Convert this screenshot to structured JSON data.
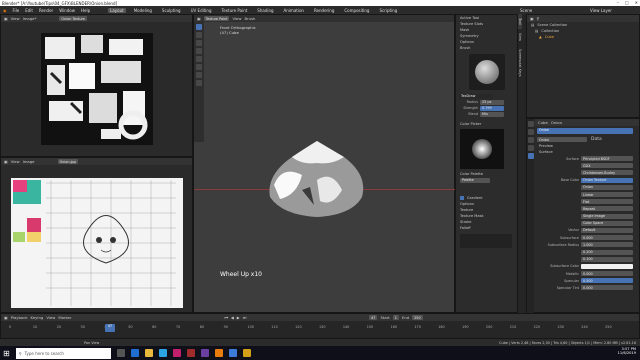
{
  "window": {
    "title": "Blender* [A:\\Youtube\\Tips\\04_GFX\\BLENDER\\Onion.blend]"
  },
  "menu": {
    "items": [
      "File",
      "Edit",
      "Render",
      "Window",
      "Help"
    ],
    "workspaces": [
      "Layout",
      "Modeling",
      "Sculpting",
      "UV Editing",
      "Texture Paint",
      "Shading",
      "Animation",
      "Rendering",
      "Compositing",
      "Scripting"
    ],
    "active_workspace": "Layout",
    "scene": "Scene",
    "view_layer": "View Layer"
  },
  "left_top": {
    "header": [
      "View",
      "Image*"
    ],
    "image_name": "Onion Texture"
  },
  "left_bottom": {
    "header": [
      "View",
      "Image"
    ],
    "image_name": "Onion.jpg"
  },
  "viewport": {
    "mode": "Texture Paint",
    "header": [
      "View",
      "Brush"
    ],
    "overlay_line1": "Front Orthographic",
    "overlay_line2": "(47) Cube",
    "operator": "Wheel Up x10"
  },
  "tool_panel": {
    "sections": [
      "Active Tool",
      "Texture Slots",
      "Mask",
      "Symmetry",
      "Options",
      "Brush"
    ],
    "brush_name": "TexDraw",
    "radius_label": "Radius",
    "radius_value": "25 px",
    "strength_label": "Strength",
    "strength_value": "0.799",
    "blend_label": "Blend",
    "blend_value": "Mix",
    "color_picker": "Color Picker",
    "color_palette": "Color Palette",
    "palette_name": "Palette",
    "lower_sections": [
      "Gradient",
      "Options",
      "Texture",
      "Texture Mask",
      "Stroke",
      "Falloff"
    ]
  },
  "side_tabs": [
    "Tool",
    "View",
    "Screencast Keys"
  ],
  "outliner": {
    "scene_collection": "Scene Collection",
    "collection": "Collection",
    "object": "Cube"
  },
  "properties": {
    "object_name": "Cube",
    "material_name": "Onion",
    "slot_name": "Onion",
    "data_label": "Data",
    "preview_label": "Preview",
    "surface_label": "Surface",
    "rows": [
      {
        "label": "Surface",
        "value": "Principled BSDF"
      },
      {
        "label": "",
        "value": "GGX"
      },
      {
        "label": "",
        "value": "Christensen-Burley"
      },
      {
        "label": "Base Color",
        "value": "Onion Texture"
      },
      {
        "label": "",
        "value": "Onion"
      },
      {
        "label": "",
        "value": "Linear"
      },
      {
        "label": "",
        "value": "Flat"
      },
      {
        "label": "",
        "value": "Repeat"
      },
      {
        "label": "",
        "value": "Single Image"
      },
      {
        "label": "",
        "value": "Color Space"
      },
      {
        "label": "Vector",
        "value": "Default"
      },
      {
        "label": "Subsurface",
        "value": "0.000"
      },
      {
        "label": "Subsurface Radius",
        "value": "1.000"
      },
      {
        "label": "",
        "value": "0.200"
      },
      {
        "label": "",
        "value": "0.100"
      },
      {
        "label": "Subsurface Color",
        "value": ""
      },
      {
        "label": "Metallic",
        "value": "0.000"
      },
      {
        "label": "Specular",
        "value": "0.500"
      },
      {
        "label": "Specular Tint",
        "value": "0.000"
      }
    ]
  },
  "timeline": {
    "header": [
      "Playback",
      "Keying",
      "View",
      "Marker"
    ],
    "current_frame": "47",
    "start_label": "Start",
    "start_value": "1",
    "end_label": "End",
    "end_value": "250",
    "frame_ticks": [
      "0",
      "10",
      "20",
      "30",
      "40",
      "50",
      "60",
      "70",
      "80",
      "90",
      "100",
      "110",
      "120",
      "130",
      "140",
      "150",
      "160",
      "170",
      "180",
      "190",
      "200",
      "210",
      "220",
      "230",
      "240",
      "250"
    ]
  },
  "status": {
    "left": "Pan View",
    "right": "Cube | Verts 2,48 | Faces 2,30 | Tris 4,60 | Objects 1/1 | Mem: 2.80 MB | v2.81.16"
  },
  "taskbar": {
    "search": "Type here to search",
    "time": "3:57 PM",
    "date": "11/6/2019"
  },
  "colors": {
    "accent": "#4772b3",
    "background": "#2a2a2a",
    "viewport": "#3d3d3d",
    "taskbar": "#0f0f1a"
  }
}
